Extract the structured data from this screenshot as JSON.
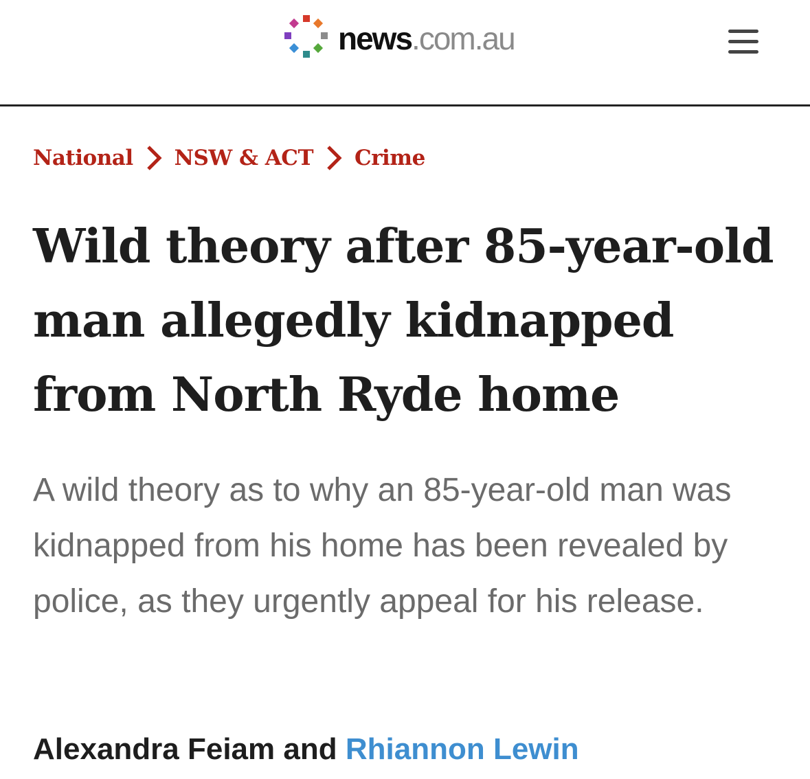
{
  "header": {
    "logo": {
      "brand": "news",
      "suffix": ".com.au"
    },
    "menu_icon": "hamburger-menu-icon"
  },
  "breadcrumb": [
    {
      "label": "National"
    },
    {
      "label": "NSW & ACT"
    },
    {
      "label": "Crime"
    }
  ],
  "article": {
    "headline": "Wild theory after 85-year-old man allegedly kidnapped from North Ryde home",
    "standfirst": "A wild theory as to why an 85-year-old man was kidnapped from his home has been revealed by police, as they urgently appeal for his release.",
    "byline": {
      "author1": "Alexandra Feiam",
      "conjunction": "and",
      "author2": "Rhiannon Lewin"
    }
  },
  "colors": {
    "breadcrumb": "#b32317",
    "headline": "#1e1e1e",
    "standfirst": "#6b6b6b",
    "link": "#3e8ed0",
    "logo_dots": [
      "#d6392a",
      "#e8782b",
      "#8c8c8c",
      "#55a83b",
      "#2e8b8b",
      "#3b8fd6",
      "#7f3fbf",
      "#c23a8f"
    ]
  }
}
